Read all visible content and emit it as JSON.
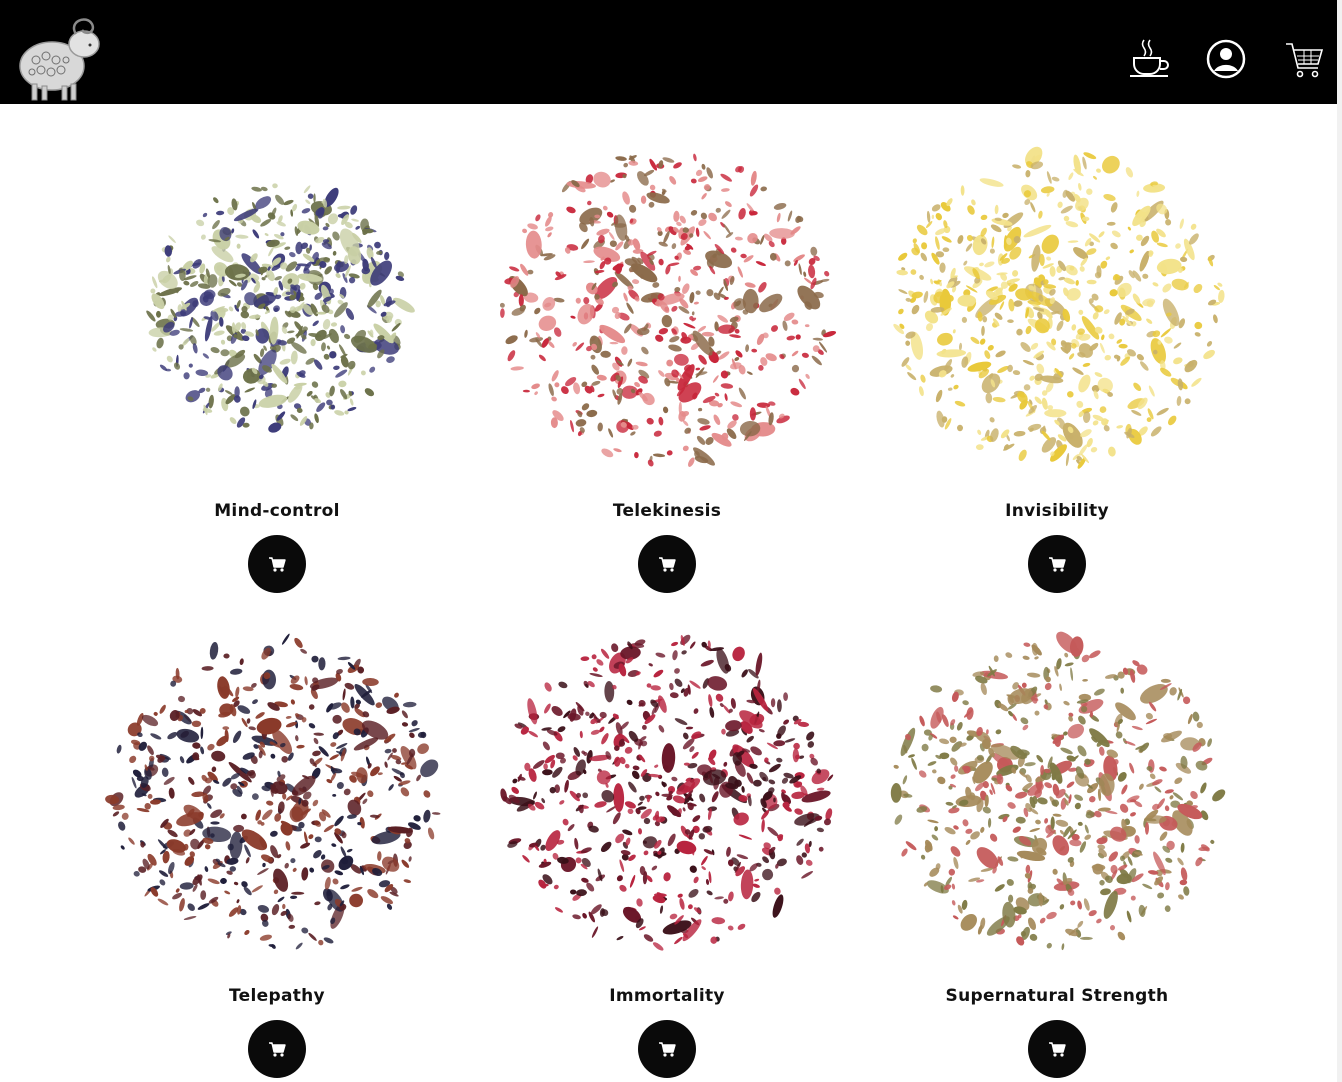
{
  "header": {
    "logo": "ram-logo",
    "icons": [
      "tea-cup-icon",
      "account-icon",
      "shopping-cart-icon"
    ],
    "background": "#000000"
  },
  "products": [
    {
      "name": "Mind-control",
      "image": "blue-butterfly-pea-tea-pile",
      "colors": [
        "#3b3a78",
        "#c9d0a6",
        "#6b7048"
      ]
    },
    {
      "name": "Telekinesis",
      "image": "red-fruit-tea-pile",
      "colors": [
        "#c8263a",
        "#8b6a4a",
        "#e48a8a"
      ]
    },
    {
      "name": "Invisibility",
      "image": "chamomile-tea-pile",
      "colors": [
        "#e9c93a",
        "#c8b06a",
        "#f3e28a"
      ]
    },
    {
      "name": "Telepathy",
      "image": "rooibos-berry-tea-pile",
      "colors": [
        "#5a1f24",
        "#8a3a2a",
        "#1f1e3a"
      ]
    },
    {
      "name": "Immortality",
      "image": "hibiscus-tea-pile",
      "colors": [
        "#6a1628",
        "#b8243f",
        "#3a0f18"
      ]
    },
    {
      "name": "Supernatural Strength",
      "image": "herbal-rose-tea-pile",
      "colors": [
        "#a58a5a",
        "#c55a5a",
        "#7f7a45"
      ]
    }
  ],
  "add_to_cart_icon": "cart-icon"
}
